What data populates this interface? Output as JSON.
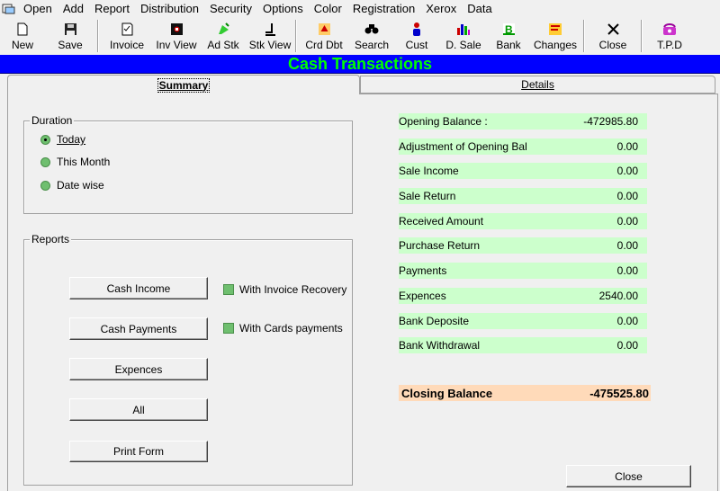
{
  "menu": {
    "items": [
      "Open",
      "Add",
      "Report",
      "Distribution",
      "Security",
      "Options",
      "Color",
      "Registration",
      "Xerox",
      "Data"
    ]
  },
  "toolbar": {
    "buttons": [
      {
        "label": "New",
        "icon": "new-file-icon"
      },
      {
        "label": "Save",
        "icon": "floppy-icon"
      },
      {
        "label": "Invoice",
        "icon": "invoice-icon"
      },
      {
        "label": "Inv View",
        "icon": "inv-view-icon"
      },
      {
        "label": "Ad Stk",
        "icon": "add-stock-icon"
      },
      {
        "label": "Stk View",
        "icon": "stock-view-icon"
      },
      {
        "label": "Crd Dbt",
        "icon": "credit-debit-icon"
      },
      {
        "label": "Search",
        "icon": "binoculars-icon"
      },
      {
        "label": "Cust",
        "icon": "customer-icon"
      },
      {
        "label": "D. Sale",
        "icon": "bar-chart-icon"
      },
      {
        "label": "Bank",
        "icon": "bank-icon"
      },
      {
        "label": "Changes",
        "icon": "changes-icon"
      },
      {
        "label": "Close",
        "icon": "close-x-icon"
      },
      {
        "label": "T.P.D",
        "icon": "phone-icon"
      }
    ]
  },
  "title": "Cash Transactions",
  "tabs": {
    "summary": "Summary",
    "details": "Details"
  },
  "duration": {
    "legend": "Duration",
    "options": [
      "Today",
      "This Month",
      "Date wise"
    ],
    "selected": "Today"
  },
  "reports": {
    "legend": "Reports",
    "buttons": [
      "Cash Income",
      "Cash Payments",
      "Expences",
      "All",
      "Print Form"
    ],
    "checks": [
      "With Invoice Recovery",
      "With Cards payments"
    ]
  },
  "summary": {
    "rows": [
      {
        "label": "Opening Balance :",
        "value": "-472985.80"
      },
      {
        "label": "Adjustment of Opening Bal",
        "value": "0.00"
      },
      {
        "label": "Sale Income",
        "value": "0.00"
      },
      {
        "label": "Sale Return",
        "value": "0.00"
      },
      {
        "label": "Received Amount",
        "value": "0.00"
      },
      {
        "label": "Purchase Return",
        "value": "0.00"
      },
      {
        "label": "Payments",
        "value": "0.00"
      },
      {
        "label": "Expences",
        "value": "2540.00"
      },
      {
        "label": "Bank Deposite",
        "value": "0.00"
      },
      {
        "label": "Bank Withdrawal",
        "value": "0.00"
      }
    ],
    "closing_label": "Closing Balance",
    "closing_value": "-475525.80"
  },
  "close_button": "Close",
  "colors": {
    "title_bg": "#0000ff",
    "title_text": "#00ff00",
    "summary_bg": "#ccffcc",
    "closing_bg": "#ffdab9"
  }
}
